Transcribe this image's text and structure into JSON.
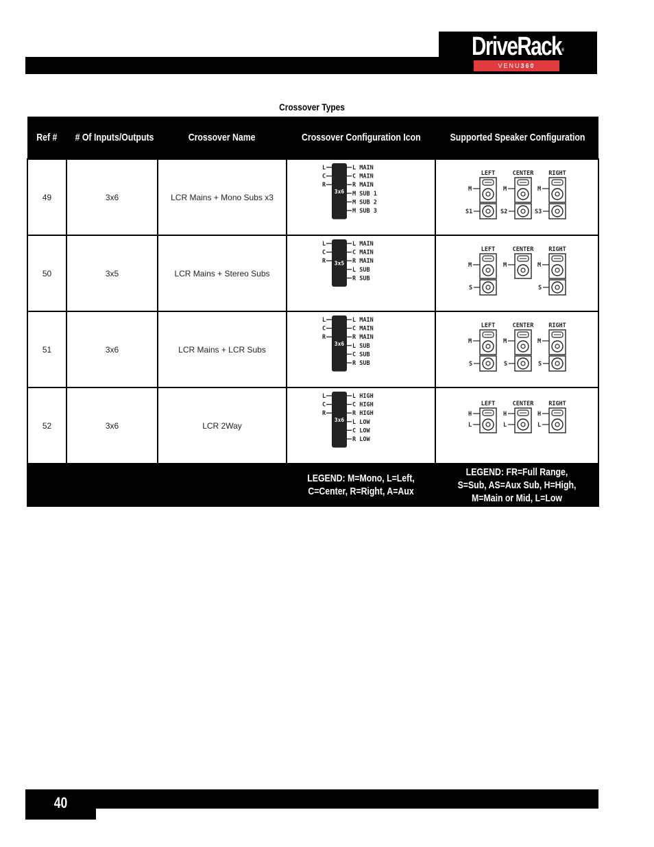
{
  "header": {
    "brand": "DriveRack",
    "trademark": "®",
    "model_prefix": "VENU",
    "model_suffix": "360"
  },
  "caption": "Crossover Types",
  "table": {
    "columns": [
      "Ref #",
      "# Of Inputs/Outputs",
      "Crossover Name",
      "Crossover Configuration Icon",
      "Supported Speaker Configuration"
    ],
    "rows": [
      {
        "ref": "49",
        "io": "3x6",
        "name": "LCR Mains + Mono Subs x3",
        "icon": {
          "box_label": "3x6",
          "inputs": [
            "L",
            "C",
            "R"
          ],
          "outputs": [
            "L MAIN",
            "C MAIN",
            "R MAIN",
            "M SUB 1",
            "M SUB 2",
            "M SUB 3"
          ]
        },
        "speakers": {
          "columns": [
            "LEFT",
            "CENTER",
            "RIGHT"
          ],
          "top_labels": [
            "M",
            "M",
            "M"
          ],
          "bottom_labels": [
            "S1",
            "S2",
            "S3"
          ],
          "bottom_present": [
            true,
            true,
            true
          ],
          "mode": "full+sub"
        }
      },
      {
        "ref": "50",
        "io": "3x5",
        "name": "LCR Mains + Stereo Subs",
        "icon": {
          "box_label": "3x5",
          "inputs": [
            "L",
            "C",
            "R"
          ],
          "outputs": [
            "L MAIN",
            "C MAIN",
            "R MAIN",
            "L SUB",
            "R SUB"
          ]
        },
        "speakers": {
          "columns": [
            "LEFT",
            "CENTER",
            "RIGHT"
          ],
          "top_labels": [
            "M",
            "M",
            "M"
          ],
          "bottom_labels": [
            "S",
            "",
            "S"
          ],
          "bottom_present": [
            true,
            false,
            true
          ],
          "mode": "full+sub"
        }
      },
      {
        "ref": "51",
        "io": "3x6",
        "name": "LCR Mains + LCR Subs",
        "icon": {
          "box_label": "3x6",
          "inputs": [
            "L",
            "C",
            "R"
          ],
          "outputs": [
            "L MAIN",
            "C MAIN",
            "R MAIN",
            "L SUB",
            "C SUB",
            "R SUB"
          ]
        },
        "speakers": {
          "columns": [
            "LEFT",
            "CENTER",
            "RIGHT"
          ],
          "top_labels": [
            "M",
            "M",
            "M"
          ],
          "bottom_labels": [
            "S",
            "S",
            "S"
          ],
          "bottom_present": [
            true,
            true,
            true
          ],
          "mode": "full+sub"
        }
      },
      {
        "ref": "52",
        "io": "3x6",
        "name": "LCR 2Way",
        "icon": {
          "box_label": "3x6",
          "inputs": [
            "L",
            "C",
            "R"
          ],
          "outputs": [
            "L HIGH",
            "C HIGH",
            "R HIGH",
            "L LOW",
            "C LOW",
            "R LOW"
          ]
        },
        "speakers": {
          "columns": [
            "LEFT",
            "CENTER",
            "RIGHT"
          ],
          "top_labels": [
            "H",
            "H",
            "H"
          ],
          "low_labels": [
            "L",
            "L",
            "L"
          ],
          "bottom_present": [
            false,
            false,
            false
          ],
          "mode": "2way"
        }
      }
    ],
    "legend_icon": "LEGEND: M=Mono, L=Left, C=Center, R=Right, A=Aux",
    "legend_speaker": "LEGEND: FR=Full Range, S=Sub, AS=Aux Sub, H=High, M=Main or Mid, L=Low"
  },
  "footer": {
    "page_number": "40"
  },
  "colors": {
    "brand_red": "#e0393e",
    "bar": "#000000"
  }
}
